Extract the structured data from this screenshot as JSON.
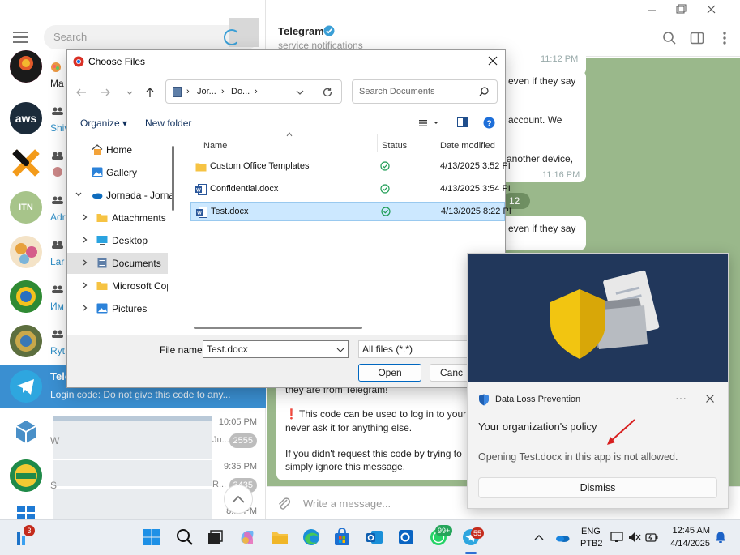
{
  "telegram": {
    "search_placeholder": "Search",
    "header": {
      "title": "Telegram",
      "subtitle": "service notifications"
    },
    "chats": [
      {
        "avatar_text": "",
        "name": "",
        "snippet": "Ma"
      },
      {
        "avatar_text": "aws",
        "name": "",
        "snippet": "Shiv"
      },
      {
        "avatar_text": "X",
        "name": "",
        "snippet": ""
      },
      {
        "avatar_text": "ITN",
        "name": "",
        "snippet": "Adr"
      },
      {
        "avatar_text": "",
        "name": "",
        "snippet": "Lar"
      },
      {
        "avatar_text": "",
        "name": "",
        "snippet": "Им"
      },
      {
        "avatar_text": "",
        "name": "",
        "snippet": "Ryt"
      }
    ],
    "active_chat": {
      "title": "Tele",
      "snippet": "Login code:  Do not give this code to any..."
    },
    "lower_rows": [
      {
        "time": "10:05 PM",
        "snippet": "Ju...",
        "badge": "2555",
        "side": "W"
      },
      {
        "time": "9:35 PM",
        "snippet": "R...",
        "badge": "3435",
        "side": "S"
      },
      {
        "time": "8:... PM",
        "snippet": "",
        "badge": "",
        "side": ""
      }
    ],
    "messages": {
      "time_top": "11:12 PM",
      "line1": "even if they say",
      "line2": "account. We",
      "line3": "another device,",
      "time2": "11:16 PM",
      "badge": "12",
      "line4": "even if they say",
      "bottom_p1": "they are from Telegram!",
      "bottom_p2a": "This code can be used to log in to your",
      "bottom_p2b": "never ask it for anything else.",
      "bottom_p3a": "If you didn't request this code by trying to",
      "bottom_p3b": "simply ignore this message.",
      "exclaim": "❗"
    },
    "compose_placeholder": "Write a message..."
  },
  "dialog": {
    "title": "Choose Files",
    "address": {
      "part1": "Jor...",
      "part2": "Do..."
    },
    "search_placeholder": "Search Documents",
    "toolbar": {
      "organize": "Organize ▾",
      "new_folder": "New folder"
    },
    "tree": [
      {
        "label": "Home",
        "icon": "home-icon"
      },
      {
        "label": "Gallery",
        "icon": "gallery-icon"
      },
      {
        "label": "Jornada - Jornac",
        "icon": "cloud-icon"
      },
      {
        "label": "Attachments",
        "icon": "folder-icon"
      },
      {
        "label": "Desktop",
        "icon": "desktop-icon"
      },
      {
        "label": "Documents",
        "icon": "documents-icon"
      },
      {
        "label": "Microsoft Cop",
        "icon": "folder-icon"
      },
      {
        "label": "Pictures",
        "icon": "pictures-icon"
      }
    ],
    "columns": {
      "name": "Name",
      "status": "Status",
      "date": "Date modified"
    },
    "files": [
      {
        "name": "Custom Office Templates",
        "date": "4/13/2025 3:52 PI",
        "type": "folder"
      },
      {
        "name": "Confidential.docx",
        "date": "4/13/2025 3:54 PI",
        "type": "word"
      },
      {
        "name": "Test.docx",
        "date": "4/13/2025 8:22 PI",
        "type": "word"
      }
    ],
    "file_name_label": "File name:",
    "file_name_value": "Test.docx",
    "file_type": "All files (*.*)",
    "open_label": "Open",
    "cancel_label": "Canc"
  },
  "toast": {
    "app_name": "Data Loss Prevention",
    "more": "···",
    "heading": "Your organization's policy",
    "body": "Opening Test.docx in this app is not allowed.",
    "dismiss": "Dismiss",
    "colors": {
      "hero": "#21375b",
      "shield": "#f2c511",
      "arrow": "#d81e1e"
    }
  },
  "taskbar": {
    "left_badge": "3",
    "whatsapp_badge": "99+",
    "telegram_badge": "55",
    "lang1": "ENG",
    "lang2": "PTB2",
    "time": "12:45 AM",
    "date": "4/14/2025"
  }
}
